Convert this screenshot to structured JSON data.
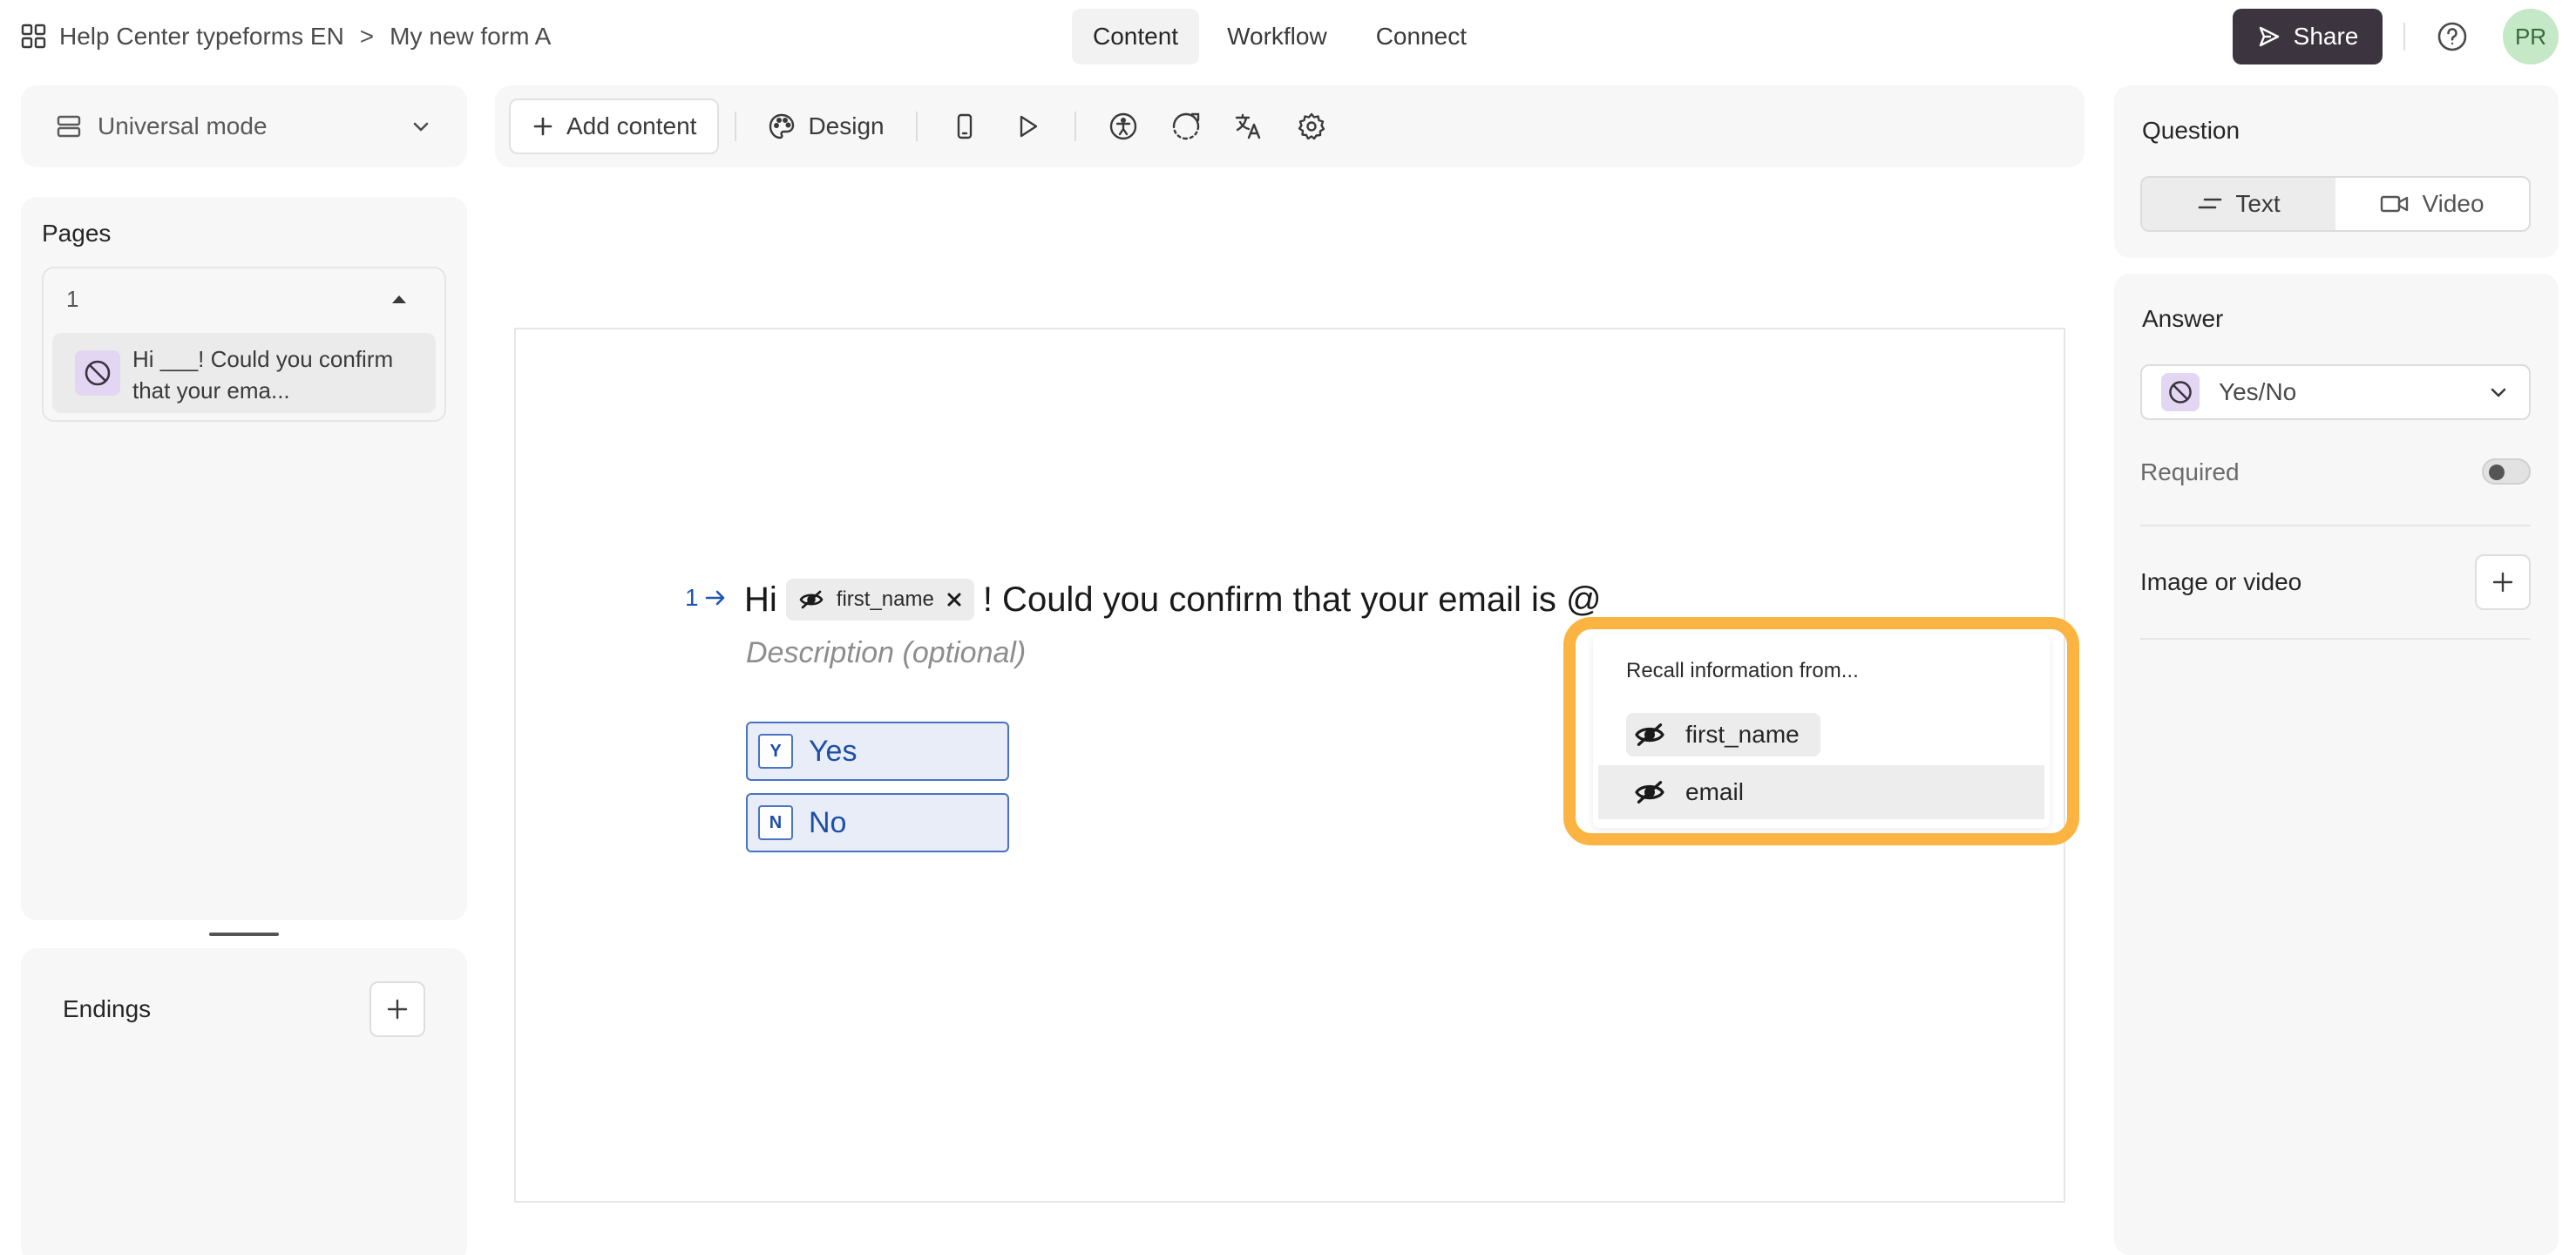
{
  "header": {
    "breadcrumb": {
      "workspace": "Help Center typeforms EN",
      "separator": ">",
      "form": "My new form A"
    },
    "tabs": [
      {
        "label": "Content",
        "active": true
      },
      {
        "label": "Workflow",
        "active": false
      },
      {
        "label": "Connect",
        "active": false
      }
    ],
    "share_label": "Share",
    "avatar_initials": "PR"
  },
  "mode_selector": {
    "label": "Universal mode"
  },
  "toolbar": {
    "add_content_label": "Add content",
    "design_label": "Design",
    "icons": [
      "mobile-preview-icon",
      "play-icon",
      "accessibility-icon",
      "loading-icon",
      "translate-icon",
      "settings-icon"
    ]
  },
  "pages": {
    "title": "Pages",
    "groups": [
      {
        "number": "1",
        "items": [
          {
            "text": "Hi ___! Could you confirm that your ema...",
            "type_icon": "yes-no-icon"
          }
        ]
      }
    ]
  },
  "endings": {
    "title": "Endings"
  },
  "canvas": {
    "question": {
      "number": "1",
      "title_prefix": "Hi",
      "recall_chip": "first_name",
      "title_suffix": "! Could you confirm that your email is @",
      "description_placeholder": "Description (optional)",
      "choices": [
        {
          "key": "Y",
          "label": "Yes"
        },
        {
          "key": "N",
          "label": "No"
        }
      ]
    },
    "recall_popup": {
      "title": "Recall information from...",
      "items": [
        {
          "label": "first_name",
          "highlighted": false
        },
        {
          "label": "email",
          "highlighted": true
        }
      ]
    }
  },
  "right_panel": {
    "question_section": {
      "title": "Question",
      "modes": [
        {
          "label": "Text",
          "active": true
        },
        {
          "label": "Video",
          "active": false
        }
      ]
    },
    "answer_section": {
      "title": "Answer",
      "type_label": "Yes/No",
      "required_label": "Required",
      "required_on": false,
      "image_video_label": "Image or video"
    }
  },
  "colors": {
    "accent_blue": "#1e56b5",
    "highlight_orange": "#fbb441",
    "share_bg": "#3c3540",
    "avatar_bg": "#c5e8c6",
    "answer_icon_bg": "#e3d6f2"
  }
}
